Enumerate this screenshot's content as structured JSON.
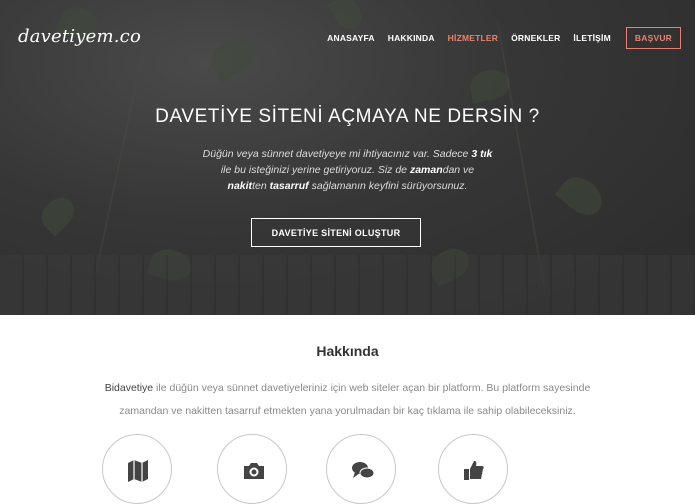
{
  "brand": {
    "logo": "davetiyem.co"
  },
  "nav": {
    "items": [
      {
        "label": "ANASAYFA",
        "active": false
      },
      {
        "label": "HAKKINDA",
        "active": false
      },
      {
        "label": "HİZMETLER",
        "active": true
      },
      {
        "label": "ÖRNEKLER",
        "active": false
      },
      {
        "label": "İLETİŞİM",
        "active": false
      }
    ],
    "apply_label": "BAŞVUR"
  },
  "hero": {
    "title": "DAVETİYE SİTENİ AÇMAYA NE DERSİN ?",
    "line1_a": "Düğün veya sünnet davetiyeye mi ihtiyacınız var. Sadece ",
    "line1_b": "3 tık",
    "line2_a": "ile bu isteğinizi yerine getiriyoruz. Siz de ",
    "line2_b": "zaman",
    "line2_c": "dan ve",
    "line3_a": "nakit",
    "line3_b": "ten ",
    "line3_c": "tasarruf",
    "line3_d": " sağlamanın keyfini sürüyorsunuz.",
    "cta_label": "DAVETİYE SİTENİ OLUŞTUR"
  },
  "about": {
    "title": "Hakkında",
    "brand_word": "Bidavetiye",
    "line1": " ile düğün veya sünnet davetiyeleriniz için web siteler açan bir platform. Bu platform sayesinde",
    "line2": "zamandan ve nakitten tasarruf etmekten yana yorulmadan bir kaç tıklama ile sahip olabileceksiniz."
  },
  "features": [
    {
      "icon": "map-icon"
    },
    {
      "icon": "camera-icon"
    },
    {
      "icon": "chat-icon"
    },
    {
      "icon": "thumbs-up-icon"
    }
  ],
  "colors": {
    "accent": "#e8826e",
    "hero_bg": "#363636"
  }
}
